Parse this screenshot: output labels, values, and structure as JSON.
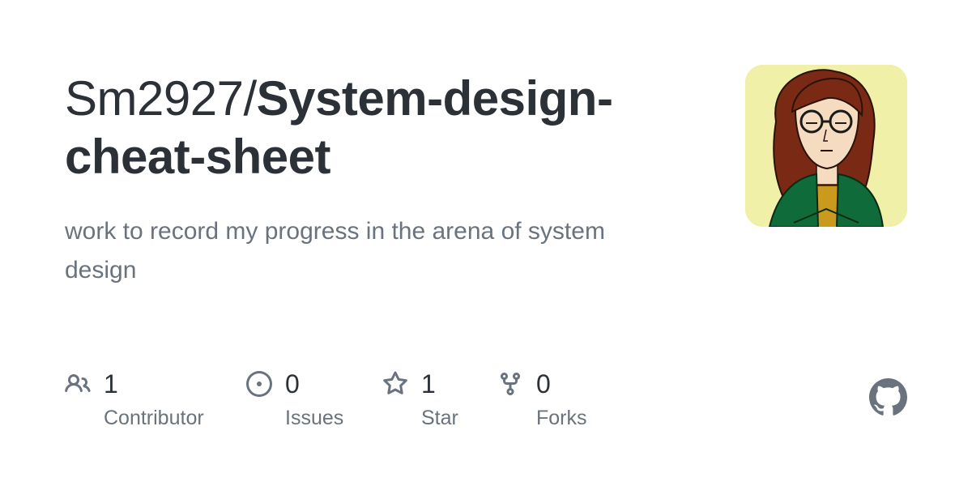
{
  "repo": {
    "owner": "Sm2927/",
    "name": "System-design-cheat-sheet",
    "description": "work to record my progress in the arena of system design"
  },
  "avatar": {
    "icon": "user-avatar",
    "background_color": "#f0f0a8"
  },
  "stats": [
    {
      "icon": "people-icon",
      "count": "1",
      "label": "Contributor"
    },
    {
      "icon": "issue-opened-icon",
      "count": "0",
      "label": "Issues"
    },
    {
      "icon": "star-icon",
      "count": "1",
      "label": "Star"
    },
    {
      "icon": "repo-forked-icon",
      "count": "0",
      "label": "Forks"
    }
  ],
  "branding": {
    "icon": "github-logo-icon",
    "color": "#6a737d"
  },
  "colors": {
    "title": "#2b3137",
    "muted": "#6a737d",
    "background": "#ffffff"
  }
}
